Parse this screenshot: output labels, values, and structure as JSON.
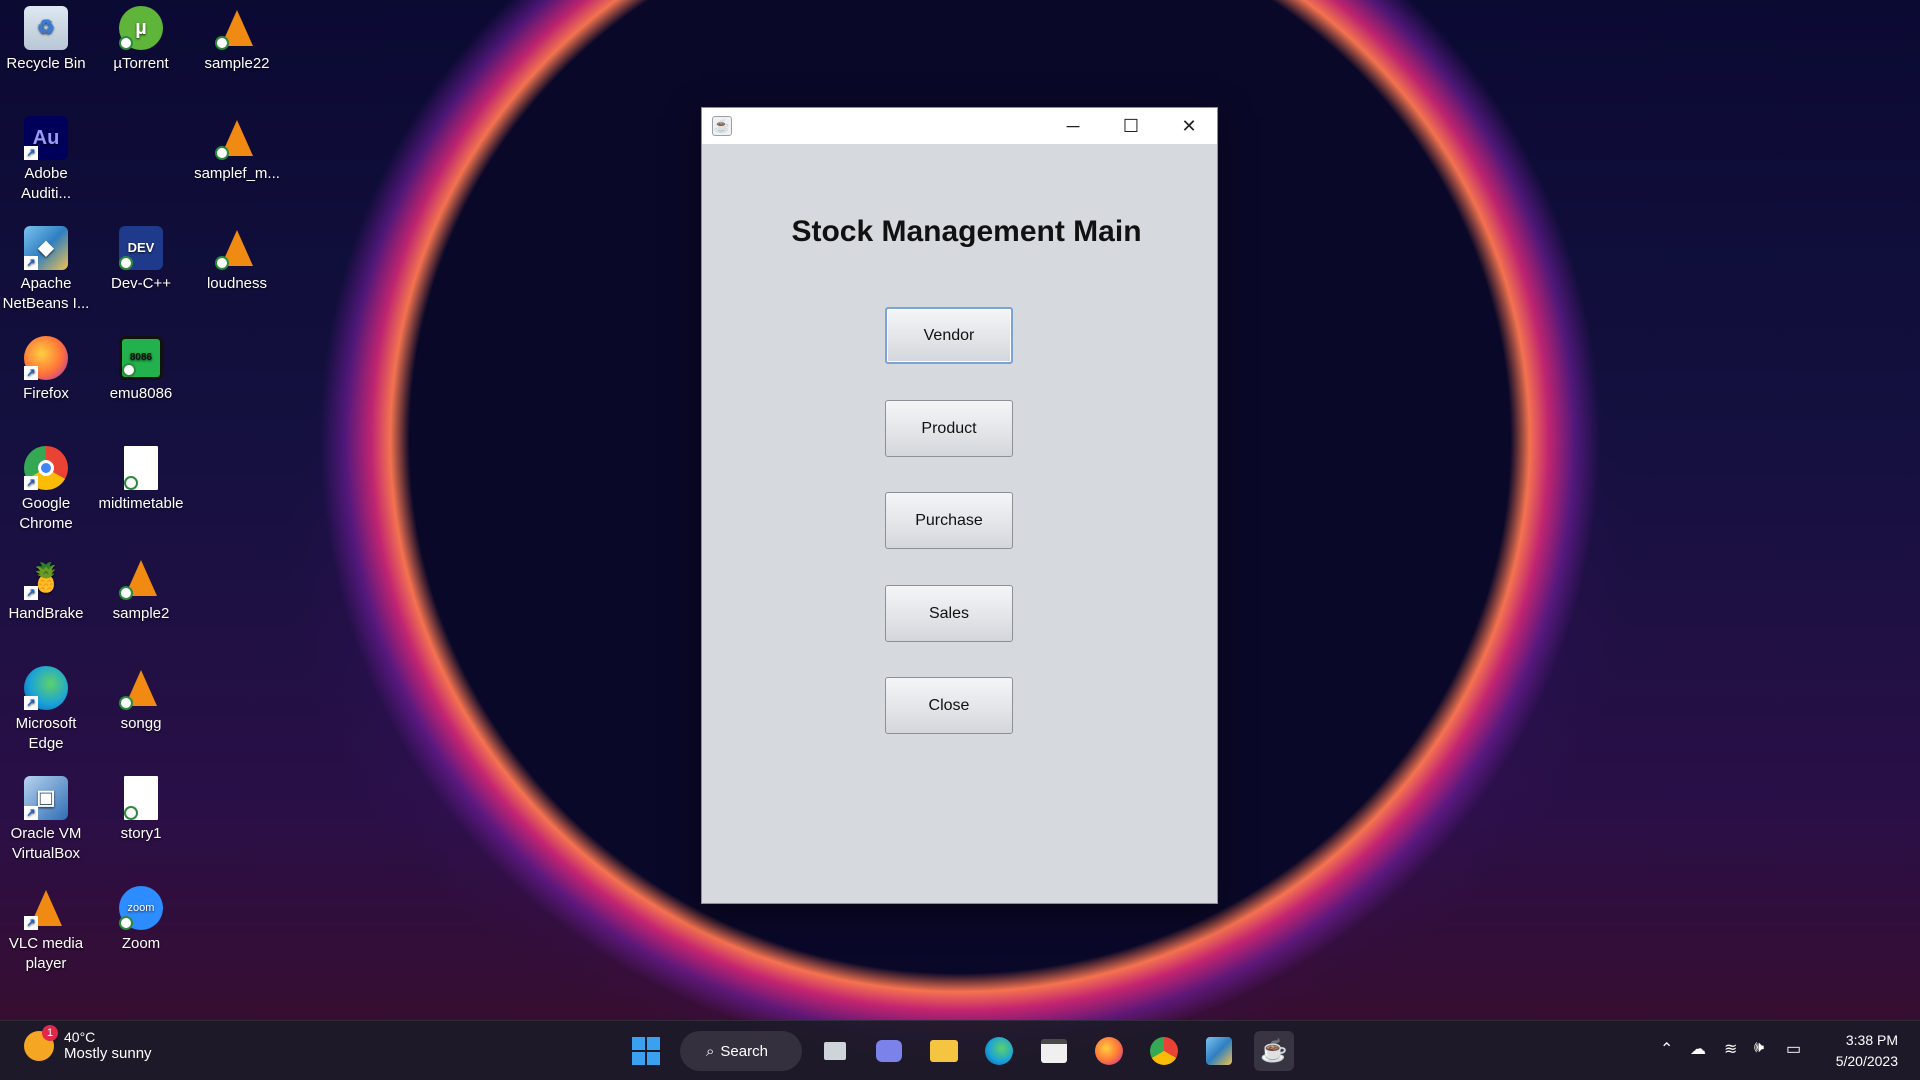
{
  "desktop": {
    "icons": [
      {
        "label": "Recycle Bin"
      },
      {
        "label": "µTorrent"
      },
      {
        "label": "sample22"
      },
      {
        "label": "Adobe Auditi..."
      },
      {
        "label": "samplef_m..."
      },
      {
        "label": "Apache NetBeans I..."
      },
      {
        "label": "Dev-C++"
      },
      {
        "label": "loudness"
      },
      {
        "label": "Firefox"
      },
      {
        "label": "emu8086"
      },
      {
        "label": "Google Chrome"
      },
      {
        "label": "midtimetable"
      },
      {
        "label": "HandBrake"
      },
      {
        "label": "sample2"
      },
      {
        "label": "Microsoft Edge"
      },
      {
        "label": "songg"
      },
      {
        "label": "Oracle VM VirtualBox"
      },
      {
        "label": "story1"
      },
      {
        "label": "VLC media player"
      },
      {
        "label": "Zoom"
      }
    ]
  },
  "window": {
    "title": "Stock Management Main",
    "buttons": {
      "vendor": "Vendor",
      "product": "Product",
      "purchase": "Purchase",
      "sales": "Sales",
      "close": "Close"
    },
    "controls": {
      "minimize": "─",
      "maximize": "☐",
      "close": "✕"
    }
  },
  "taskbar": {
    "weather": {
      "temp": "40°C",
      "desc": "Mostly sunny",
      "badge": "1"
    },
    "search_label": "Search",
    "clock": {
      "time": "3:38 PM",
      "date": "5/20/2023"
    }
  }
}
